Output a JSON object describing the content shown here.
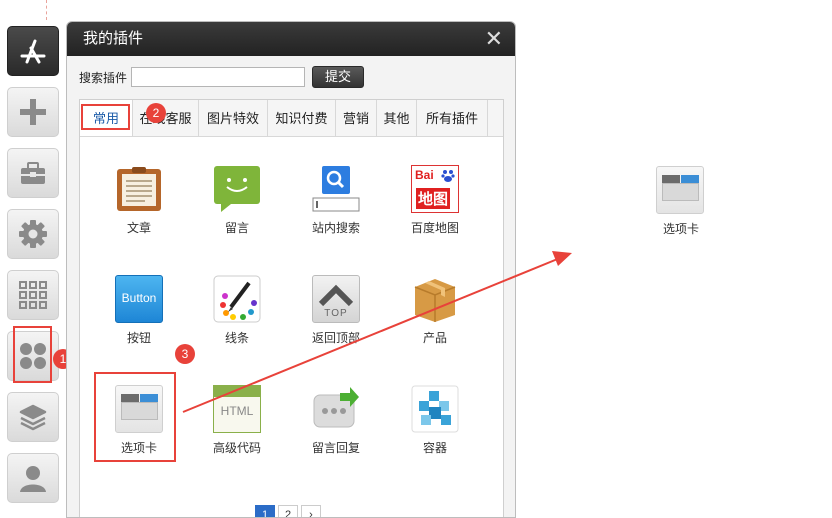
{
  "dialog": {
    "title": "我的插件",
    "close": "✕",
    "search_label": "搜索插件",
    "search_value": "",
    "submit_label": "提交"
  },
  "tabs": [
    "常用",
    "在线客服",
    "图片特效",
    "知识付费",
    "营销",
    "其他",
    "所有插件"
  ],
  "plugins": [
    {
      "label": "文章",
      "icon": "article-icon"
    },
    {
      "label": "留言",
      "icon": "message-icon"
    },
    {
      "label": "站内搜索",
      "icon": "site-search-icon"
    },
    {
      "label": "百度地图",
      "icon": "baidu-map-icon",
      "logo_text": "Bai",
      "logo_text2": "地图"
    },
    {
      "label": "按钮",
      "icon": "button-icon",
      "button_text": "Button"
    },
    {
      "label": "线条",
      "icon": "line-icon"
    },
    {
      "label": "返回顶部",
      "icon": "back-to-top-icon",
      "top_text": "TOP"
    },
    {
      "label": "产品",
      "icon": "product-icon"
    },
    {
      "label": "选项卡",
      "icon": "tabs-icon"
    },
    {
      "label": "高级代码",
      "icon": "html-code-icon",
      "html_text": "HTML"
    },
    {
      "label": "留言回复",
      "icon": "message-reply-icon"
    },
    {
      "label": "容器",
      "icon": "container-icon"
    }
  ],
  "pagination": [
    "1",
    "2",
    "›"
  ],
  "badges": [
    "1",
    "2",
    "3"
  ],
  "dropped_item": {
    "label": "选项卡"
  },
  "toolbar": [
    "app-store-icon",
    "plus-icon",
    "toolbox-icon",
    "gear-icon",
    "grid-icon",
    "plugins-icon",
    "layers-icon",
    "user-icon"
  ],
  "colors": {
    "accent": "#e8423a",
    "tab_active": "#1a5aa8",
    "page_current": "#2b6cc7"
  }
}
